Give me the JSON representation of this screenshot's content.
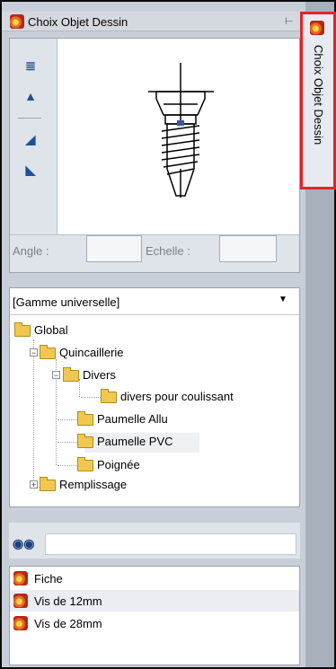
{
  "panel": {
    "title": "Choix Objet Dessin",
    "side_tab_label": "Choix Objet Dessin"
  },
  "preview": {
    "angle_label": "Angle :",
    "scale_label": "Echelle :",
    "angle_value": "",
    "scale_value": ""
  },
  "tree": {
    "range_selected": "[Gamme universelle]",
    "items": [
      {
        "label": "Global"
      },
      {
        "label": "Quincaillerie"
      },
      {
        "label": "Divers"
      },
      {
        "label": "divers pour coulissant"
      },
      {
        "label": "Paumelle Allu"
      },
      {
        "label": "Paumelle PVC"
      },
      {
        "label": "Poignée"
      },
      {
        "label": "Remplissage"
      }
    ]
  },
  "search": {
    "value": ""
  },
  "objects": [
    {
      "label": "Fiche"
    },
    {
      "label": "Vis de 12mm"
    },
    {
      "label": "Vis de 28mm"
    }
  ],
  "colors": {
    "highlight_border": "#e3222e",
    "folder": "#f0c850",
    "tool_icon": "#1e4f9c"
  }
}
